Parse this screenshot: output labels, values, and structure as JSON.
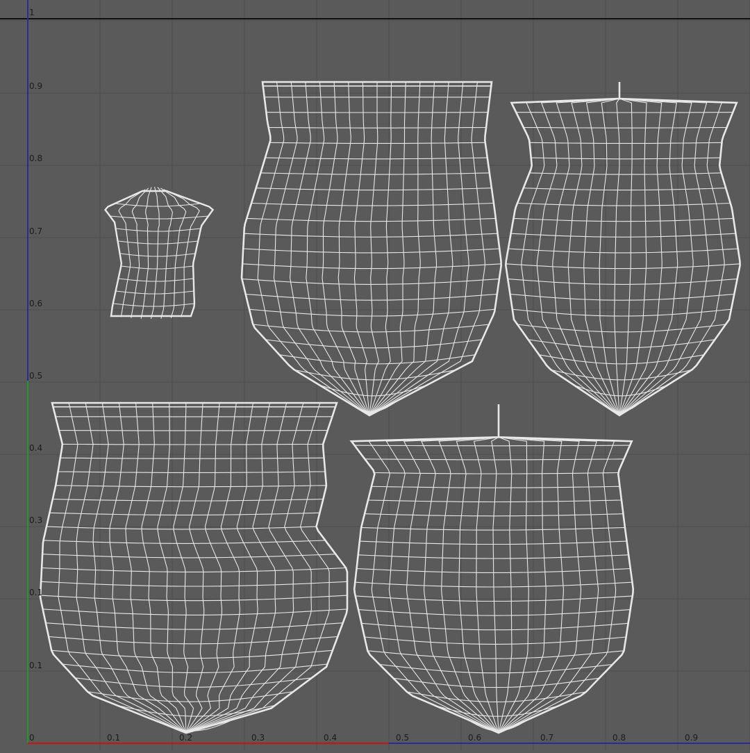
{
  "viewport": {
    "u_labels": [
      "0",
      "0.1",
      "0.2",
      "0.3",
      "0.4",
      "0.5",
      "0.6",
      "0.7",
      "0.8",
      "0.9"
    ],
    "v_labels": [
      "1",
      "0.9",
      "0.8",
      "0.7",
      "0.6",
      "0.5",
      "0.4",
      "0.3",
      "0.1",
      "0.1"
    ]
  },
  "colors": {
    "background": "#5a5a5a",
    "grid_line": "#4f4f4f",
    "uv_wire": "#e8e8e8",
    "u_axis": "#b02020",
    "v_axis_lower": "#1f9a2a",
    "v_axis_upper": "#2a2aa0",
    "top_border": "#101010"
  },
  "uv_shells": [
    {
      "name": "uv-shell-small-strip"
    },
    {
      "name": "uv-shell-upper-center"
    },
    {
      "name": "uv-shell-upper-right"
    },
    {
      "name": "uv-shell-lower-left"
    },
    {
      "name": "uv-shell-lower-right"
    }
  ]
}
